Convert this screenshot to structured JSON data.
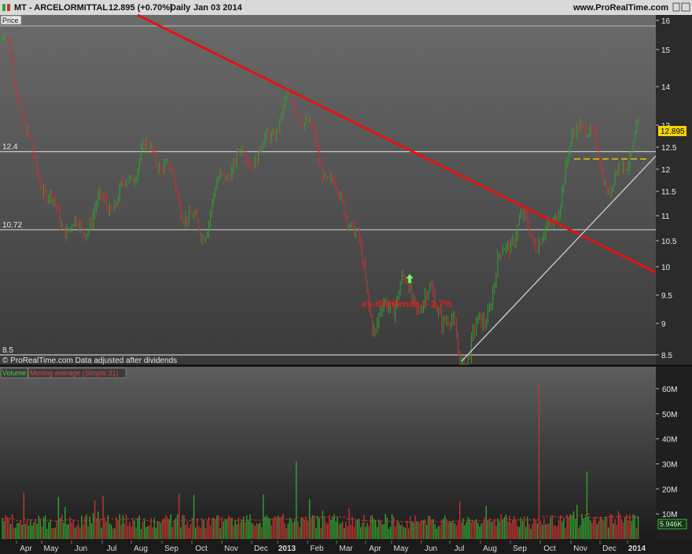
{
  "header": {
    "symbol": "MT - ARCELORMITTAL",
    "quote": "12.895 (+0.70%)",
    "period": "Daily",
    "date": "Jan 03 2014",
    "site": "www.ProRealTime.com"
  },
  "price_panel": {
    "label": "Price",
    "footnote": "© ProRealTime.com Data adjusted after dividends",
    "last_price_badge": "12.895",
    "annotation": "ex-dividendo = 1.7%",
    "levels": [
      {
        "value": 12.4,
        "label": "12.4"
      },
      {
        "value": 10.72,
        "label": "10.72"
      },
      {
        "value": 8.5,
        "label": "8.5"
      }
    ]
  },
  "volume_panel": {
    "label_volume": "Volume",
    "label_ma": "Moving average (Simple 31)",
    "last_volume_badge": "5.946K"
  },
  "colors": {
    "up": "#2fa32f",
    "down": "#c23434",
    "trendline": "#e01414",
    "support": "#c8c8c8",
    "badge": "#f5d400"
  },
  "chart_data": [
    {
      "type": "candlestick",
      "title": "MT - ARCELORMITTAL",
      "ylim": [
        8.3,
        16.1
      ],
      "y_ticks": [
        8.5,
        9,
        9.5,
        10,
        10.5,
        11,
        11.5,
        12,
        12.5,
        13,
        14,
        15,
        16
      ],
      "x_ticks": [
        "Apr",
        "May",
        "Jun",
        "Jul",
        "Aug",
        "Sep",
        "Oct",
        "Nov",
        "Dec",
        "2013",
        "Feb",
        "Mar",
        "Apr",
        "May",
        "Jun",
        "Jul",
        "Aug",
        "Sep",
        "Oct",
        "Nov",
        "Dec",
        "2014"
      ],
      "key_points": [
        {
          "t": "Mar 2012",
          "close": 15.2
        },
        {
          "t": "Apr 2012",
          "close": 12.5
        },
        {
          "t": "Jun 2012",
          "close": 10.4
        },
        {
          "t": "Aug 2012",
          "close": 12.4
        },
        {
          "t": "Oct 2012",
          "close": 10.9
        },
        {
          "t": "Jan 2013",
          "close": 13.5
        },
        {
          "t": "Mar 2013",
          "close": 11.4
        },
        {
          "t": "Apr 2013",
          "close": 8.6
        },
        {
          "t": "May 2013",
          "close": 10.0
        },
        {
          "t": "Jul 2013",
          "close": 8.5
        },
        {
          "t": "Sep 2013",
          "close": 10.6
        },
        {
          "t": "Oct 2013",
          "close": 10.9
        },
        {
          "t": "Nov 2013",
          "close": 12.9
        },
        {
          "t": "Dec 2013",
          "close": 11.8
        },
        {
          "t": "Jan 2014",
          "close": 12.895
        }
      ],
      "trendlines": [
        {
          "name": "",
          "from": {
            "t": "Mar 2012",
            "y": 16.1
          },
          "to": {
            "t": "Jan 2014",
            "y": 9.9
          }
        },
        {
          "name": "",
          "from": {
            "t": "Jul 2013",
            "y": 8.4
          },
          "to": {
            "t": "Jan 2014",
            "y": 12.3
          }
        }
      ]
    },
    {
      "type": "bar",
      "title": "Volume",
      "ylim": [
        0,
        65
      ],
      "y_ticks": [
        "10M",
        "20M",
        "30M",
        "40M",
        "50M",
        "60M"
      ],
      "moving_average": "Simple 31",
      "notable_values_millions": [
        {
          "t": "Jan 2013",
          "value": 31
        },
        {
          "t": "Sep 2013",
          "value": 62
        },
        {
          "t": "Nov 2013",
          "value": 27
        }
      ]
    }
  ]
}
